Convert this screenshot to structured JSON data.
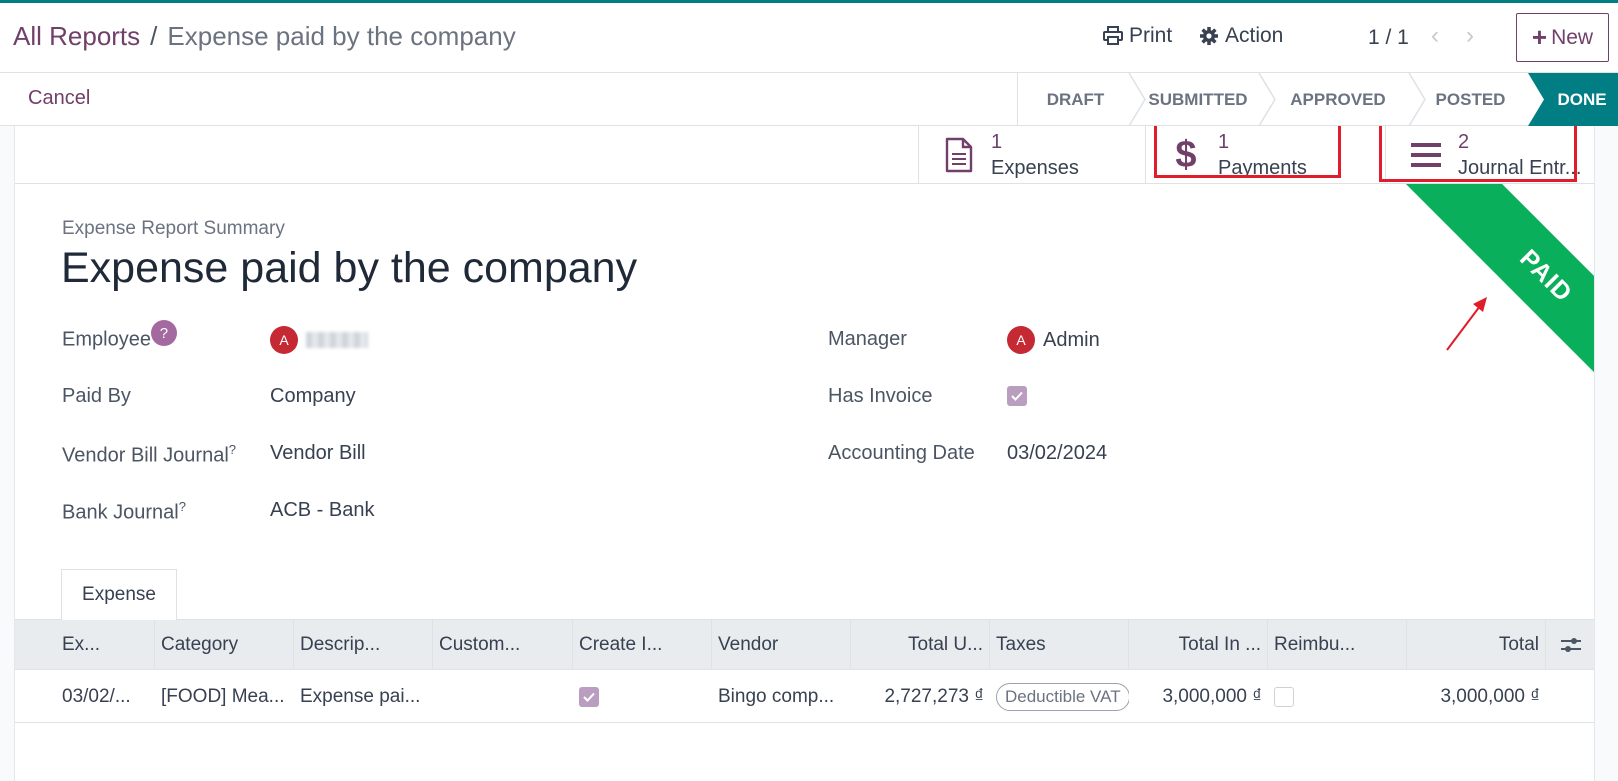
{
  "header": {
    "breadcrumb_parent": "All Reports",
    "breadcrumb_separator": "/",
    "breadcrumb_current": "Expense paid by the company",
    "print_label": "Print",
    "action_label": "Action",
    "pager": "1 / 1",
    "new_label": "New"
  },
  "statusbar": {
    "cancel_label": "Cancel",
    "stages": [
      "DRAFT",
      "SUBMITTED",
      "APPROVED",
      "POSTED",
      "DONE"
    ],
    "active_stage": "DONE"
  },
  "smart_buttons": [
    {
      "count": "1",
      "label": "Expenses",
      "icon": "document-icon"
    },
    {
      "count": "1",
      "label": "Payments",
      "icon": "dollar-icon"
    },
    {
      "count": "2",
      "label": "Journal Entr...",
      "icon": "list-icon"
    }
  ],
  "ribbon": "PAID",
  "form": {
    "subtitle": "Expense Report Summary",
    "title": "Expense paid by the company",
    "employee_label": "Employee",
    "employee_help": "?",
    "employee_initial": "A",
    "paid_by_label": "Paid By",
    "paid_by_value": "Company",
    "vendor_bill_journal_label": "Vendor Bill Journal",
    "vendor_bill_journal_value": "Vendor Bill",
    "bank_journal_label": "Bank Journal",
    "bank_journal_value": "ACB - Bank",
    "help_mark": "?",
    "manager_label": "Manager",
    "manager_initial": "A",
    "manager_value": "Admin",
    "has_invoice_label": "Has Invoice",
    "has_invoice_checked": true,
    "accounting_date_label": "Accounting Date",
    "accounting_date_value": "03/02/2024"
  },
  "notebook": {
    "tab_label": "Expense"
  },
  "table": {
    "columns": [
      "Ex...",
      "Category",
      "Descrip...",
      "Custom...",
      "Create I...",
      "Vendor",
      "Total U...",
      "Taxes",
      "Total In ...",
      "Reimbu...",
      "Total"
    ],
    "row": {
      "date": "03/02/...",
      "category": "[FOOD] Mea...",
      "description": "Expense pai...",
      "customer": "",
      "create_invoice_checked": true,
      "vendor": "Bingo comp...",
      "total_untaxed": "2,727,273 ₫",
      "tax_tag": "Deductible VAT",
      "total_incl": "3,000,000 ₫",
      "reimbursed_checked": false,
      "total": "3,000,000 ₫"
    }
  },
  "colors": {
    "brand": "#71406a",
    "active_stage": "#017e84",
    "ribbon": "#0aaf5c",
    "highlight": "#e01e2b"
  }
}
